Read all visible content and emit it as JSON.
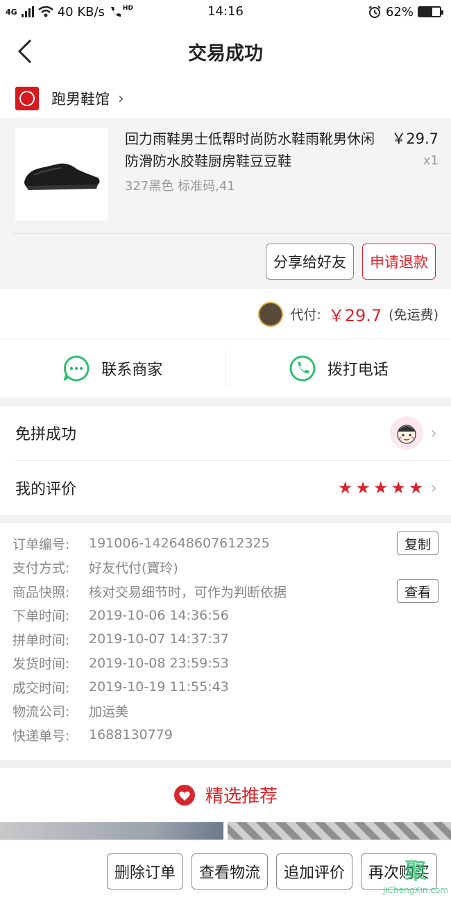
{
  "status_bar": {
    "network": "4G",
    "speed": "40 KB/s",
    "hd": "HD",
    "time": "14:16",
    "battery": "62%",
    "battery_level": 0.62
  },
  "nav": {
    "title": "交易成功"
  },
  "shop": {
    "name": "跑男鞋馆"
  },
  "product": {
    "title": "回力雨鞋男士低帮时尚防水鞋雨靴男休闲防滑防水胶鞋厨房鞋豆豆鞋",
    "spec": "327黑色 标准码,41",
    "price": "￥29.7",
    "qty": "x1",
    "share_label": "分享给好友",
    "refund_label": "申请退款"
  },
  "payment": {
    "label": "代付:",
    "amount": "￥29.7",
    "note": "(免运费)"
  },
  "contact": {
    "merchant_label": "联系商家",
    "call_label": "拨打电话"
  },
  "group": {
    "label": "免拼成功"
  },
  "review": {
    "label": "我的评价",
    "stars": 5
  },
  "order_info": {
    "rows": [
      {
        "label": "订单编号:",
        "value": "191006-142648607612325",
        "button": "复制"
      },
      {
        "label": "支付方式:",
        "value": "好友代付(寶玲)",
        "button": ""
      },
      {
        "label": "商品快照:",
        "value": "核对交易细节时，可作为判断依据",
        "button": "查看"
      },
      {
        "label": "下单时间:",
        "value": "2019-10-06 14:36:56",
        "button": ""
      },
      {
        "label": "拼单时间:",
        "value": "2019-10-07 14:37:37",
        "button": ""
      },
      {
        "label": "发货时间:",
        "value": "2019-10-08 23:59:53",
        "button": ""
      },
      {
        "label": "成交时间:",
        "value": "2019-10-19 11:55:43",
        "button": ""
      },
      {
        "label": "物流公司:",
        "value": "加运美",
        "button": ""
      },
      {
        "label": "快递单号:",
        "value": "1688130779",
        "button": ""
      }
    ]
  },
  "recommend": {
    "title": "精选推荐"
  },
  "bottom": {
    "delete_label": "删除订单",
    "logistics_label": "查看物流",
    "add_review_label": "追加评价",
    "rebuy_label": "再次购买"
  },
  "watermark": {
    "logo": "聚",
    "text": "JiChengXin.com"
  },
  "colors": {
    "accent_red": "#d8262d",
    "wechat_green": "#2fbf71"
  }
}
